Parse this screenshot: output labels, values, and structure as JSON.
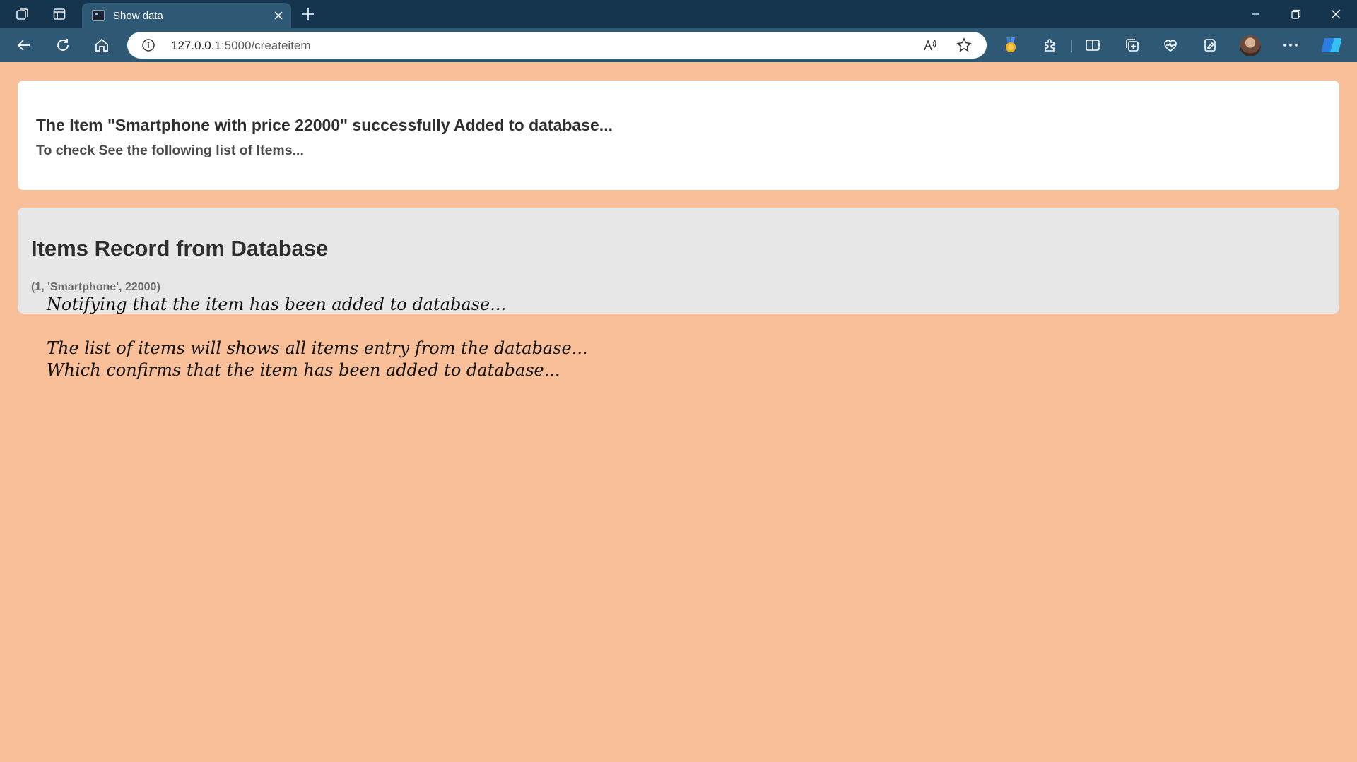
{
  "browser": {
    "tab_title": "Show data",
    "url_host": "127.0.0.1",
    "url_rest": ":5000/createitem"
  },
  "page": {
    "success": {
      "title": "The Item \"Smartphone with price 22000\" successfully Added to database...",
      "subtitle": "To check See the following list of Items..."
    },
    "records": {
      "title": "Items Record from Database",
      "rows": [
        "(1, 'Smartphone', 22000)"
      ]
    },
    "notes": {
      "line1": "Notifying that the item has been added to database...",
      "line2": "The list of items will shows all items entry from the database...",
      "line3": "Which confirms that the item has been added to database..."
    }
  },
  "colors": {
    "page_background": "#f8bf98",
    "title_bar": "#15354f",
    "toolbar": "#2f5875",
    "success_card": "#ffffff",
    "records_card": "#e7e7e7"
  }
}
